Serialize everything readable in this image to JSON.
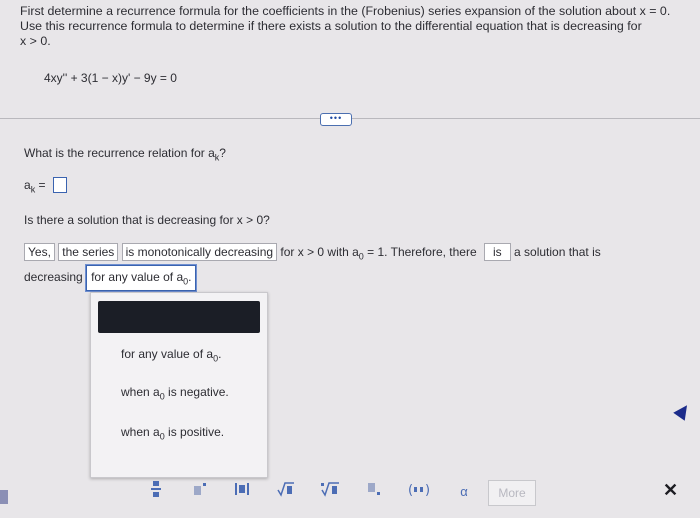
{
  "question": {
    "intro_line1": "First determine a recurrence formula for the coefficients in the (Frobenius) series expansion of the solution about x = 0.",
    "intro_line2": "Use this recurrence formula to determine if there exists a solution to the differential equation that is decreasing for",
    "intro_line3": "x > 0.",
    "equation": "4xy'' + 3(1 − x)y' − 9y = 0"
  },
  "expand_label": "•••",
  "part1": {
    "prompt": "What is the recurrence relation for a",
    "prompt_sub": "k",
    "prompt_end": "?",
    "ak_label": "a",
    "ak_sub": "k",
    "equals": "="
  },
  "part2": {
    "prompt": "Is there a solution that is decreasing for x > 0?",
    "yes": "Yes,",
    "series": "the series",
    "monotone": "is monotonically decreasing",
    "for_x": "for x > 0 with a",
    "for_x_sub": "0",
    "eq1": "= 1. Therefore, there",
    "is": "is",
    "sol_decr": "a solution that is",
    "decreasing": "decreasing",
    "any_value": "for any value of a",
    "any_value_sub": "0",
    "period": "."
  },
  "dropdown": {
    "items": [
      {
        "text": "for any value of a",
        "sub": "0",
        "end": "."
      },
      {
        "text": "when a",
        "sub": "0",
        "end": " is negative."
      },
      {
        "text": "when a",
        "sub": "0",
        "end": " is positive."
      }
    ]
  },
  "toolbar": {
    "fraction_icon": "fraction-icon",
    "superscript_icon": "superscript-icon",
    "abs_icon": "absolute-value-icon",
    "sqrt_icon": "sqrt-icon",
    "nthroot_icon": "nth-root-icon",
    "subscript_icon": "subscript-icon",
    "interval_icon": "interval-icon",
    "alpha": "α",
    "more": "More",
    "close": "✕"
  }
}
